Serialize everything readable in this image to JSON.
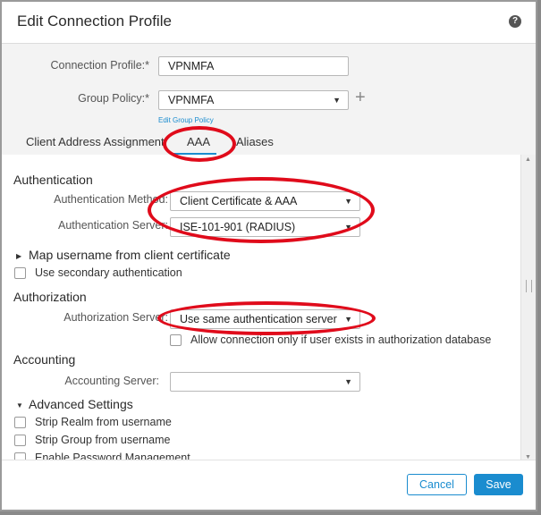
{
  "dialog": {
    "title": "Edit Connection Profile",
    "help_glyph": "?"
  },
  "form": {
    "connection_profile_label": "Connection Profile:*",
    "connection_profile_value": "VPNMFA",
    "group_policy_label": "Group Policy:*",
    "group_policy_value": "VPNMFA",
    "edit_group_policy_link": "Edit Group Policy",
    "add_glyph": "+"
  },
  "tabs": [
    {
      "label": "Client Address Assignment",
      "active": false
    },
    {
      "label": "AAA",
      "active": true
    },
    {
      "label": "Aliases",
      "active": false
    }
  ],
  "authentication": {
    "heading": "Authentication",
    "method_label": "Authentication Method:",
    "method_value": "Client Certificate & AAA",
    "server_label": "Authentication Server:",
    "server_value": "ISE-101-901 (RADIUS)",
    "map_username_label": "Map username from client certificate",
    "secondary_auth_label": "Use secondary authentication",
    "secondary_auth_checked": false
  },
  "authorization": {
    "heading": "Authorization",
    "server_label": "Authorization Server:",
    "server_value": "Use same authentication server",
    "allow_connection_label": "Allow connection only if user exists in authorization database",
    "allow_connection_checked": false
  },
  "accounting": {
    "heading": "Accounting",
    "server_label": "Accounting Server:",
    "server_value": ""
  },
  "advanced": {
    "heading": "Advanced Settings",
    "options": [
      {
        "label": "Strip Realm from username",
        "checked": false
      },
      {
        "label": "Strip Group from username",
        "checked": false
      },
      {
        "label": "Enable Password Management",
        "checked": false
      }
    ]
  },
  "footer": {
    "cancel_label": "Cancel",
    "save_label": "Save"
  },
  "colors": {
    "accent": "#1a8ccf",
    "annotation": "#e00b1b"
  }
}
